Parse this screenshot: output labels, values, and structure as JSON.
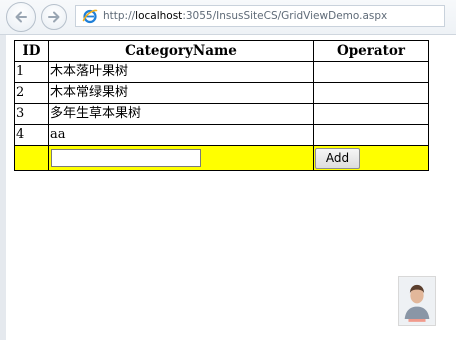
{
  "browser": {
    "url_prefix": "http://",
    "url_host": "localhost",
    "url_rest": ":3055/InsusSiteCS/GridViewDemo.aspx"
  },
  "grid": {
    "columns": [
      "ID",
      "CategoryName",
      "Operator"
    ],
    "rows": [
      {
        "id": "1",
        "name": "木本落叶果树",
        "operator": ""
      },
      {
        "id": "2",
        "name": "木本常绿果树",
        "operator": ""
      },
      {
        "id": "3",
        "name": "多年生草本果树",
        "operator": ""
      },
      {
        "id": "4",
        "name": "aa",
        "operator": ""
      }
    ],
    "insert_row": {
      "input_value": "",
      "add_label": "Add",
      "highlight_color": "#ffff00"
    }
  }
}
